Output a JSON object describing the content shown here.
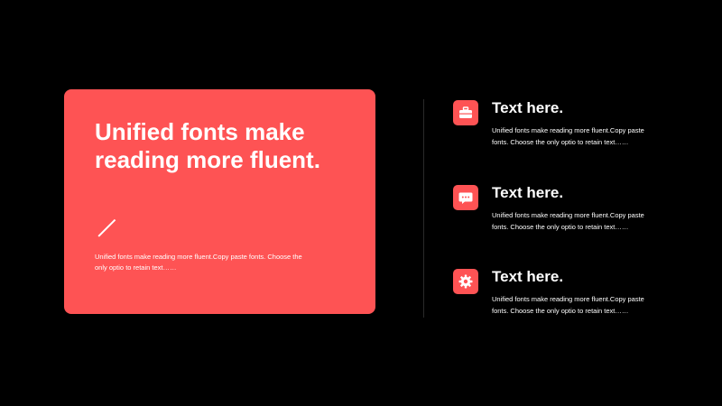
{
  "card": {
    "title": "Unified fonts make reading more fluent.",
    "body": "Unified fonts make reading more fluent.Copy paste fonts. Choose the only optio to retain text……"
  },
  "items": [
    {
      "icon": "briefcase-icon",
      "title": "Text here.",
      "body": "Unified fonts make reading more fluent.Copy paste fonts. Choose the only optio to retain text……"
    },
    {
      "icon": "chat-bubble-icon",
      "title": "Text here.",
      "body": "Unified fonts make reading more fluent.Copy paste fonts. Choose the only optio to retain text……"
    },
    {
      "icon": "gear-icon",
      "title": "Text here.",
      "body": "Unified fonts make reading more fluent.Copy paste fonts. Choose the only optio to retain text……"
    }
  ],
  "colors": {
    "accent": "#fe5354",
    "background": "#000000",
    "text": "#ffffff"
  }
}
